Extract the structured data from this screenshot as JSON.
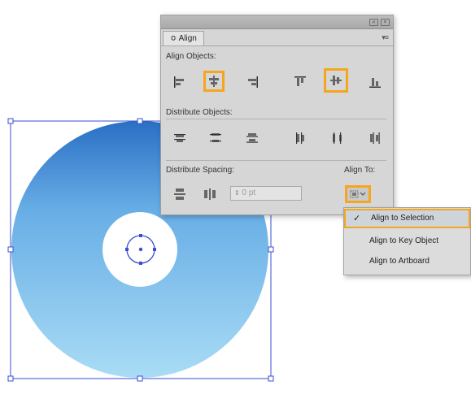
{
  "panel": {
    "tab_label": "≎ Align",
    "align_objects_label": "Align Objects:",
    "distribute_objects_label": "Distribute Objects:",
    "distribute_spacing_label": "Distribute Spacing:",
    "align_to_label": "Align To:",
    "spacing_value": "0 pt",
    "align_objects_buttons": [
      "horizontal-align-left-icon",
      "horizontal-align-center-icon",
      "horizontal-align-right-icon",
      "vertical-align-top-icon",
      "vertical-align-center-icon",
      "vertical-align-bottom-icon"
    ],
    "highlighted_buttons": [
      "horizontal-align-center-icon",
      "vertical-align-center-icon"
    ],
    "distribute_objects_buttons": [
      "vertical-distribute-top-icon",
      "vertical-distribute-center-icon",
      "vertical-distribute-bottom-icon",
      "horizontal-distribute-left-icon",
      "horizontal-distribute-center-icon",
      "horizontal-distribute-right-icon"
    ]
  },
  "menu": {
    "items": [
      {
        "label": "Align to Selection",
        "checked": true
      },
      {
        "label": "Align to Key Object",
        "checked": false
      },
      {
        "label": "Align to Artboard",
        "checked": false
      }
    ],
    "check_glyph": "✓"
  },
  "artwork": {
    "gradient_top": "#2a6fc4",
    "gradient_bottom": "#a9dcf5",
    "selection_color": "#3a4fd0"
  },
  "colors": {
    "highlight": "#f5a51e"
  }
}
